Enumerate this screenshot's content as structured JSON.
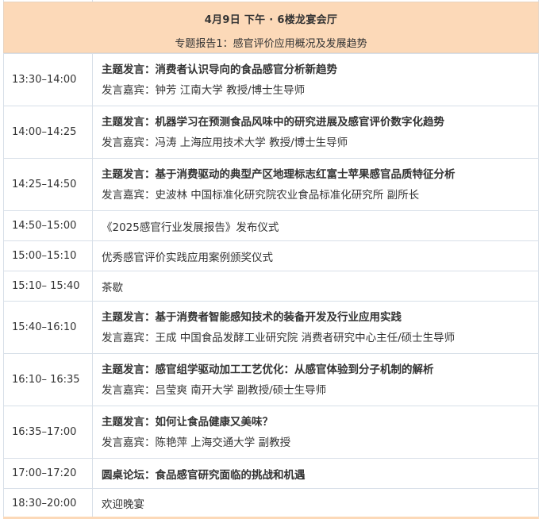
{
  "header": {
    "title": "4月9日 下午 · 6楼龙宴会厅",
    "subtitle": "专题报告1：感官评价应用概况及发展趋势"
  },
  "rows": [
    {
      "time": "13:30–14:00",
      "title": "主题发言：消费者认识导向的食品感官分析新趋势",
      "speaker": "发言嘉宾：钟芳  江南大学  教授/博士生导师"
    },
    {
      "time": "14:00–14:25",
      "title": "主题发言：机器学习在预测食品风味中的研究进展及感官评价数字化趋势",
      "speaker": "发言嘉宾：冯涛  上海应用技术大学  教授/博士生导师"
    },
    {
      "time": "14:25–14:50",
      "title": "主题发言：基于消费驱动的典型产区地理标志红富士苹果感官品质特征分析",
      "speaker": "发言嘉宾：史波林  中国标准化研究院农业食品标准化研究所  副所长"
    },
    {
      "time": "14:50–15:00",
      "text": "《2025感官行业发展报告》发布仪式"
    },
    {
      "time": "15:00–15:10",
      "text": "优秀感官评价实践应用案例颁奖仪式"
    },
    {
      "time": "15:10– 15:40",
      "text": "茶歇"
    },
    {
      "time": "15:40–16:10",
      "title": "主题发言：基于消费者智能感知技术的装备开发及行业应用实践",
      "speaker": "发言嘉宾：王成  中国食品发酵工业研究院  消费者研究中心主任/硕士生导师"
    },
    {
      "time": "16:10– 16:35",
      "title": "主题发言：感官组学驱动加工工艺优化：从感官体验到分子机制的解析",
      "speaker": "发言嘉宾：吕莹爽  南开大学  副教授/硕士生导师"
    },
    {
      "time": "16:35–17:00",
      "title": "主题发言：如何让食品健康又美味？",
      "speaker": "发言嘉宾：陈艳萍  上海交通大学  副教授"
    },
    {
      "time": "17:00–17:20",
      "text": "圆桌论坛：食品感官研究面临的挑战和机遇",
      "bold": true
    },
    {
      "time": "18:30–20:00",
      "text": "欢迎晚宴"
    }
  ]
}
